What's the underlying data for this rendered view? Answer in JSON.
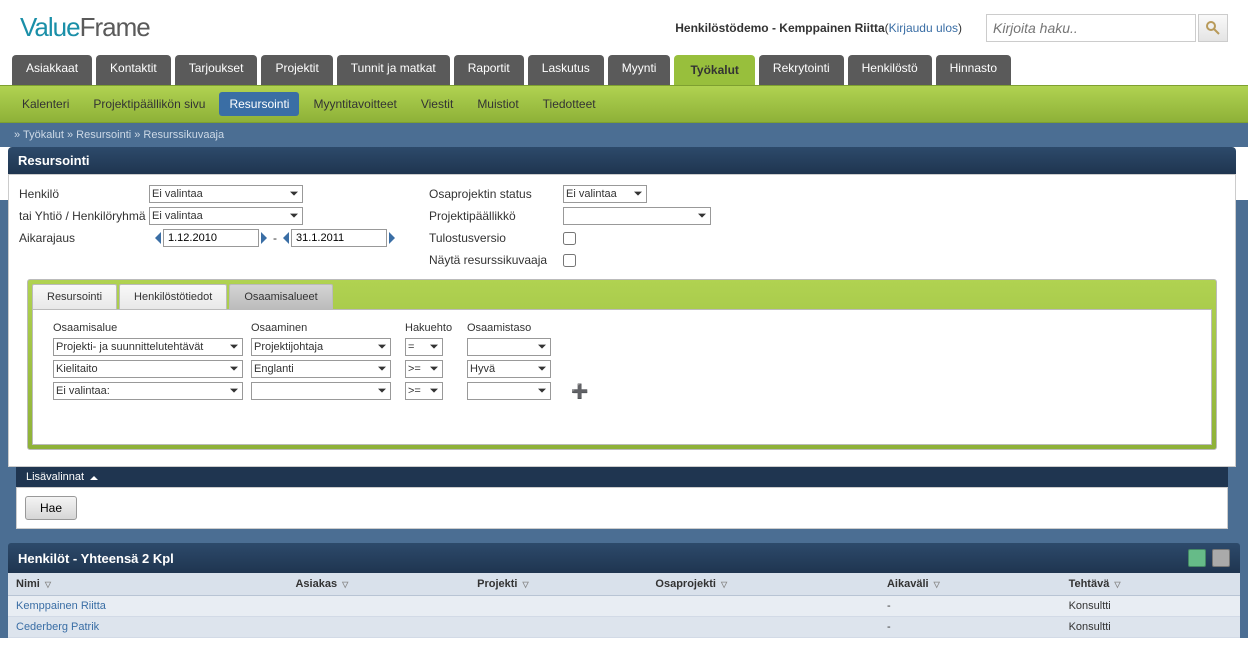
{
  "logo": {
    "p1": "Value",
    "p2": "Frame"
  },
  "header": {
    "demo": "Henkilöstödemo - Kemppainen Riitta",
    "logout": "Kirjaudu ulos",
    "search_placeholder": "Kirjoita haku.."
  },
  "nav": {
    "items": [
      "Asiakkaat",
      "Kontaktit",
      "Tarjoukset",
      "Projektit",
      "Tunnit ja matkat",
      "Raportit",
      "Laskutus",
      "Myynti",
      "Työkalut",
      "Rekrytointi",
      "Henkilöstö",
      "Hinnasto"
    ],
    "active": "Työkalut"
  },
  "subnav": {
    "items": [
      "Kalenteri",
      "Projektipäällikön sivu",
      "Resursointi",
      "Myyntitavoitteet",
      "Viestit",
      "Muistiot",
      "Tiedotteet"
    ],
    "active": "Resursointi"
  },
  "breadcrumb": "» Työkalut » Resursointi » Resurssikuvaaja",
  "panel_title": "Resursointi",
  "filters": {
    "left": [
      {
        "label": "Henkilö",
        "value": "Ei valintaa"
      },
      {
        "label": "tai Yhtiö / Henkilöryhmä",
        "value": "Ei valintaa"
      },
      {
        "label": "Aikarajaus",
        "from": "1.12.2010",
        "to": "31.1.2011"
      }
    ],
    "right": [
      {
        "label": "Osaprojektin status",
        "value": "Ei valintaa",
        "type": "sel"
      },
      {
        "label": "Projektipäällikkö",
        "value": "",
        "type": "sel"
      },
      {
        "label": "Tulostusversio",
        "type": "chk"
      },
      {
        "label": "Näytä resurssikuvaaja",
        "type": "chk"
      }
    ]
  },
  "tabs": {
    "items": [
      "Resursointi",
      "Henkilöstötiedot",
      "Osaamisalueet"
    ],
    "active": "Osaamisalueet",
    "headers": [
      "Osaamisalue",
      "Osaaminen",
      "Hakuehto",
      "Osaamistaso"
    ],
    "rows": [
      {
        "area": "Projekti- ja suunnittelutehtävät",
        "skill": "Projektijohtaja",
        "op": "=",
        "level": ""
      },
      {
        "area": "Kielitaito",
        "skill": "Englanti",
        "op": ">=",
        "level": "Hyvä"
      },
      {
        "area": "Ei valintaa:",
        "skill": "",
        "op": ">=",
        "level": ""
      }
    ]
  },
  "lisavalinnat": "Lisävalinnat",
  "hae": "Hae",
  "results": {
    "title": "Henkilöt - Yhteensä 2 Kpl",
    "cols": [
      "Nimi",
      "Asiakas",
      "Projekti",
      "Osaprojekti",
      "Aikaväli",
      "Tehtävä"
    ],
    "rows": [
      {
        "nimi": "Kemppainen Riitta",
        "asiakas": "",
        "projekti": "",
        "osa": "",
        "aika": "-",
        "tehtava": "Konsultti"
      },
      {
        "nimi": "Cederberg Patrik",
        "asiakas": "",
        "projekti": "",
        "osa": "",
        "aika": "-",
        "tehtava": "Konsultti"
      }
    ]
  }
}
